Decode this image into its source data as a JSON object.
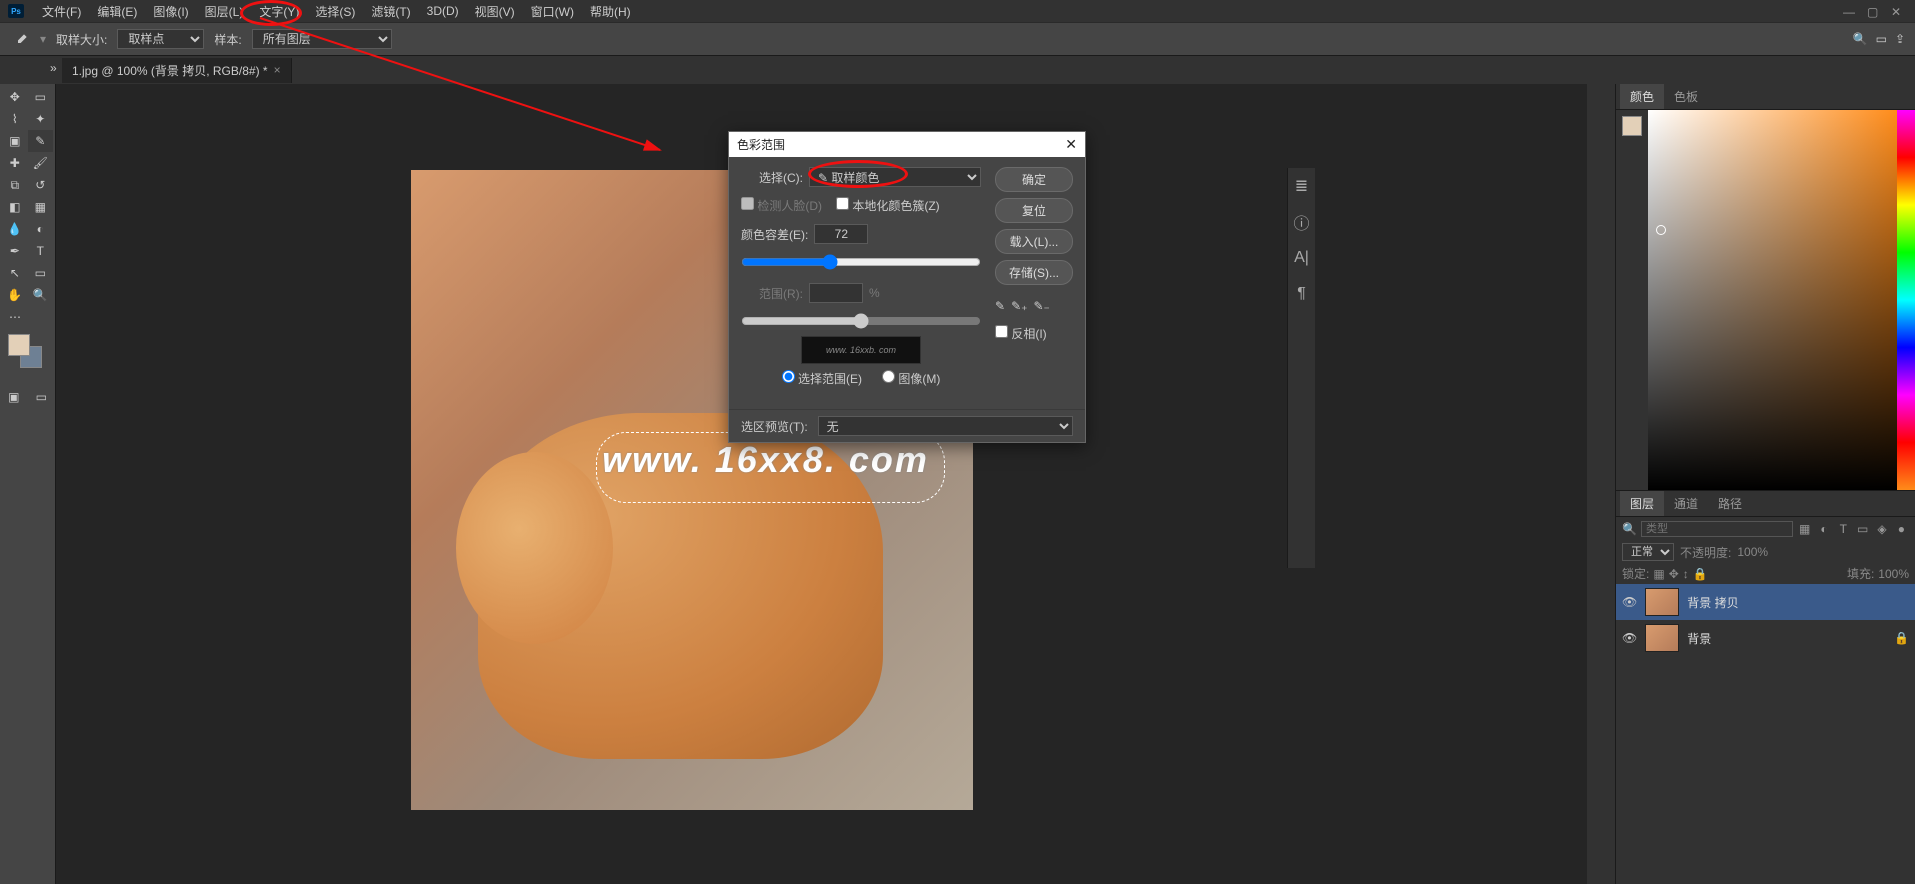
{
  "app": {
    "logo_text": "Ps"
  },
  "menu": [
    "文件(F)",
    "编辑(E)",
    "图像(I)",
    "图层(L)",
    "文字(Y)",
    "选择(S)",
    "滤镜(T)",
    "3D(D)",
    "视图(V)",
    "窗口(W)",
    "帮助(H)"
  ],
  "options": {
    "sample_size_label": "取样大小:",
    "sample_size_value": "取样点",
    "sample_label": "样本:",
    "sample_value": "所有图层"
  },
  "tab": {
    "title": "1.jpg @ 100% (背景 拷贝, RGB/8#) *"
  },
  "watermark": "www. 16xx8. com",
  "dialog": {
    "title": "色彩范围",
    "select_label": "选择(C):",
    "select_value": "取样颜色",
    "detect_faces_label": "检测人脸(D)",
    "local_clusters_label": "本地化颜色簇(Z)",
    "fuzziness_label": "颜色容差(E):",
    "fuzziness_value": "72",
    "range_label": "范围(R):",
    "range_unit": "%",
    "radio_selection": "选择范围(E)",
    "radio_image": "图像(M)",
    "preview_watermark": "www. 16xxb. com",
    "buttons": {
      "ok": "确定",
      "reset": "复位",
      "load": "载入(L)...",
      "save": "存储(S)..."
    },
    "invert_label": "反相(I)",
    "preview_select_label": "选区预览(T):",
    "preview_select_value": "无"
  },
  "panels": {
    "color_tabs": [
      "颜色",
      "色板"
    ],
    "layers_tabs": [
      "图层",
      "通道",
      "路径"
    ],
    "filter_placeholder": "类型",
    "blend_mode": "正常",
    "opacity_label": "不透明度:",
    "opacity_value": "100%",
    "lock_label": "锁定:",
    "fill_label": "填充:",
    "fill_value": "100%",
    "layers": [
      {
        "name": "背景 拷贝",
        "selected": true,
        "locked": false
      },
      {
        "name": "背景",
        "selected": false,
        "locked": true
      }
    ]
  }
}
